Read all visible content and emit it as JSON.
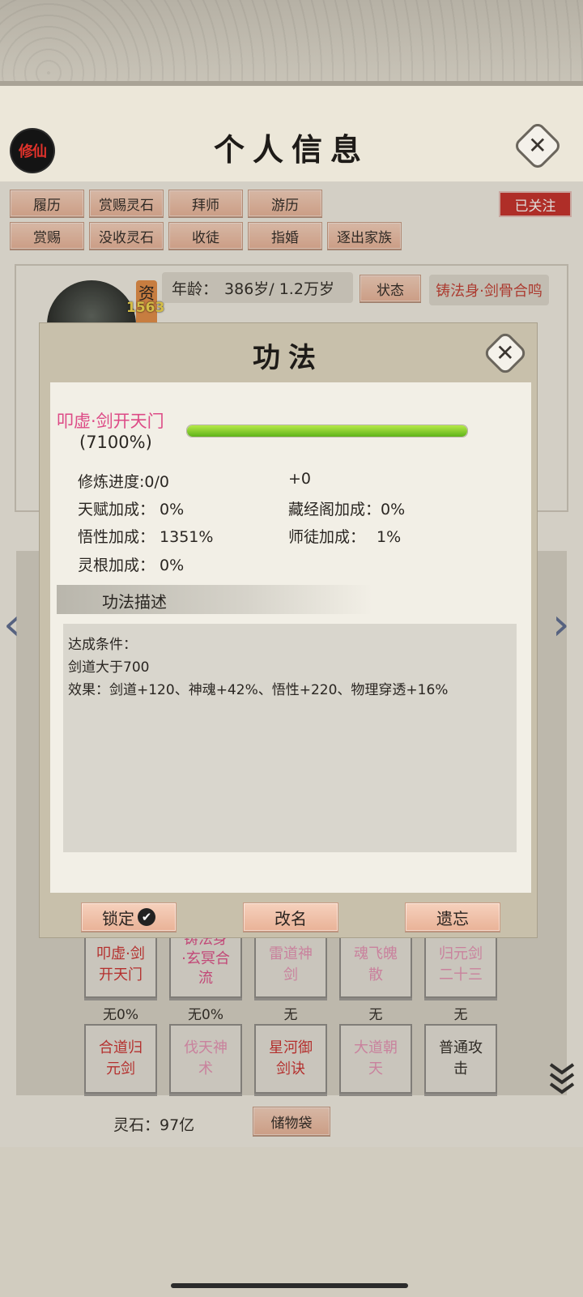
{
  "header": {
    "seal_text": "修仙",
    "title": "个人信息",
    "close_glyph": "✕"
  },
  "actions_row1": [
    "履历",
    "赏赐灵石",
    "拜师",
    "游历"
  ],
  "actions_row2": [
    "赏赐",
    "没收灵石",
    "收徒",
    "指婚",
    "逐出家族"
  ],
  "follow_label": "已关注",
  "profile": {
    "qualification_label": "资",
    "qualification_value": "1563",
    "age_label": "年龄：",
    "age_value": "386岁/ 1.2万岁",
    "state_button": "状态",
    "body_state": "铸法身·剑骨合鸣"
  },
  "modal": {
    "title": "功法",
    "close_glyph": "✕",
    "skill_name": "叩虚·剑开天门",
    "skill_percent": "(7100%)",
    "progress_fraction": 1.0,
    "stats": {
      "cultivation_label": "修炼进度:",
      "cultivation_value": "0/0",
      "cultivation_bonus": "+0",
      "talent_label": "天赋加成：",
      "talent_value": "0%",
      "library_label": "藏经阁加成：",
      "library_value": "0%",
      "comprehension_label": "悟性加成：",
      "comprehension_value": "1351%",
      "mentor_label": "师徒加成：",
      "mentor_value": "1%",
      "root_label": "灵根加成：",
      "root_value": "0%"
    },
    "desc_title": "功法描述",
    "desc_lines": [
      "达成条件：",
      "剑道大于700",
      "效果：剑道+120、神魂+42%、悟性+220、物理穿透+16%"
    ],
    "buttons": {
      "lock": "锁定",
      "lock_check": "✔",
      "rename": "改名",
      "forget": "遗忘"
    }
  },
  "skills_row1": [
    {
      "line1": "叩虚·剑",
      "line2": "开天门",
      "color": "#cc2d2d"
    },
    {
      "line1": "铸法身",
      "line2": "·玄冥合",
      "line3": "流",
      "color": "#dd4a86"
    },
    {
      "line1": "雷道神",
      "line2": "剑",
      "color": "#e690b4"
    },
    {
      "line1": "魂飞魄",
      "line2": "散",
      "color": "#e690b4"
    },
    {
      "line1": "归元剑",
      "line2": "二十三",
      "color": "#e690b4"
    }
  ],
  "skills_row1_pct": [
    "无0%",
    "无0%",
    "无",
    "无",
    "无"
  ],
  "skills_row2": [
    {
      "line1": "合道归",
      "line2": "元剑",
      "color": "#cc2d2d"
    },
    {
      "line1": "伐天神",
      "line2": "术",
      "color": "#e690b4"
    },
    {
      "line1": "星河御",
      "line2": "剑诀",
      "color": "#cc2d2d"
    },
    {
      "line1": "大道朝",
      "line2": "天",
      "color": "#e690b4"
    },
    {
      "line1": "普通攻",
      "line2": "击",
      "color": "#2a2622"
    }
  ],
  "footer": {
    "spirit_stones": "灵石：97亿",
    "bag_label": "储物袋"
  }
}
